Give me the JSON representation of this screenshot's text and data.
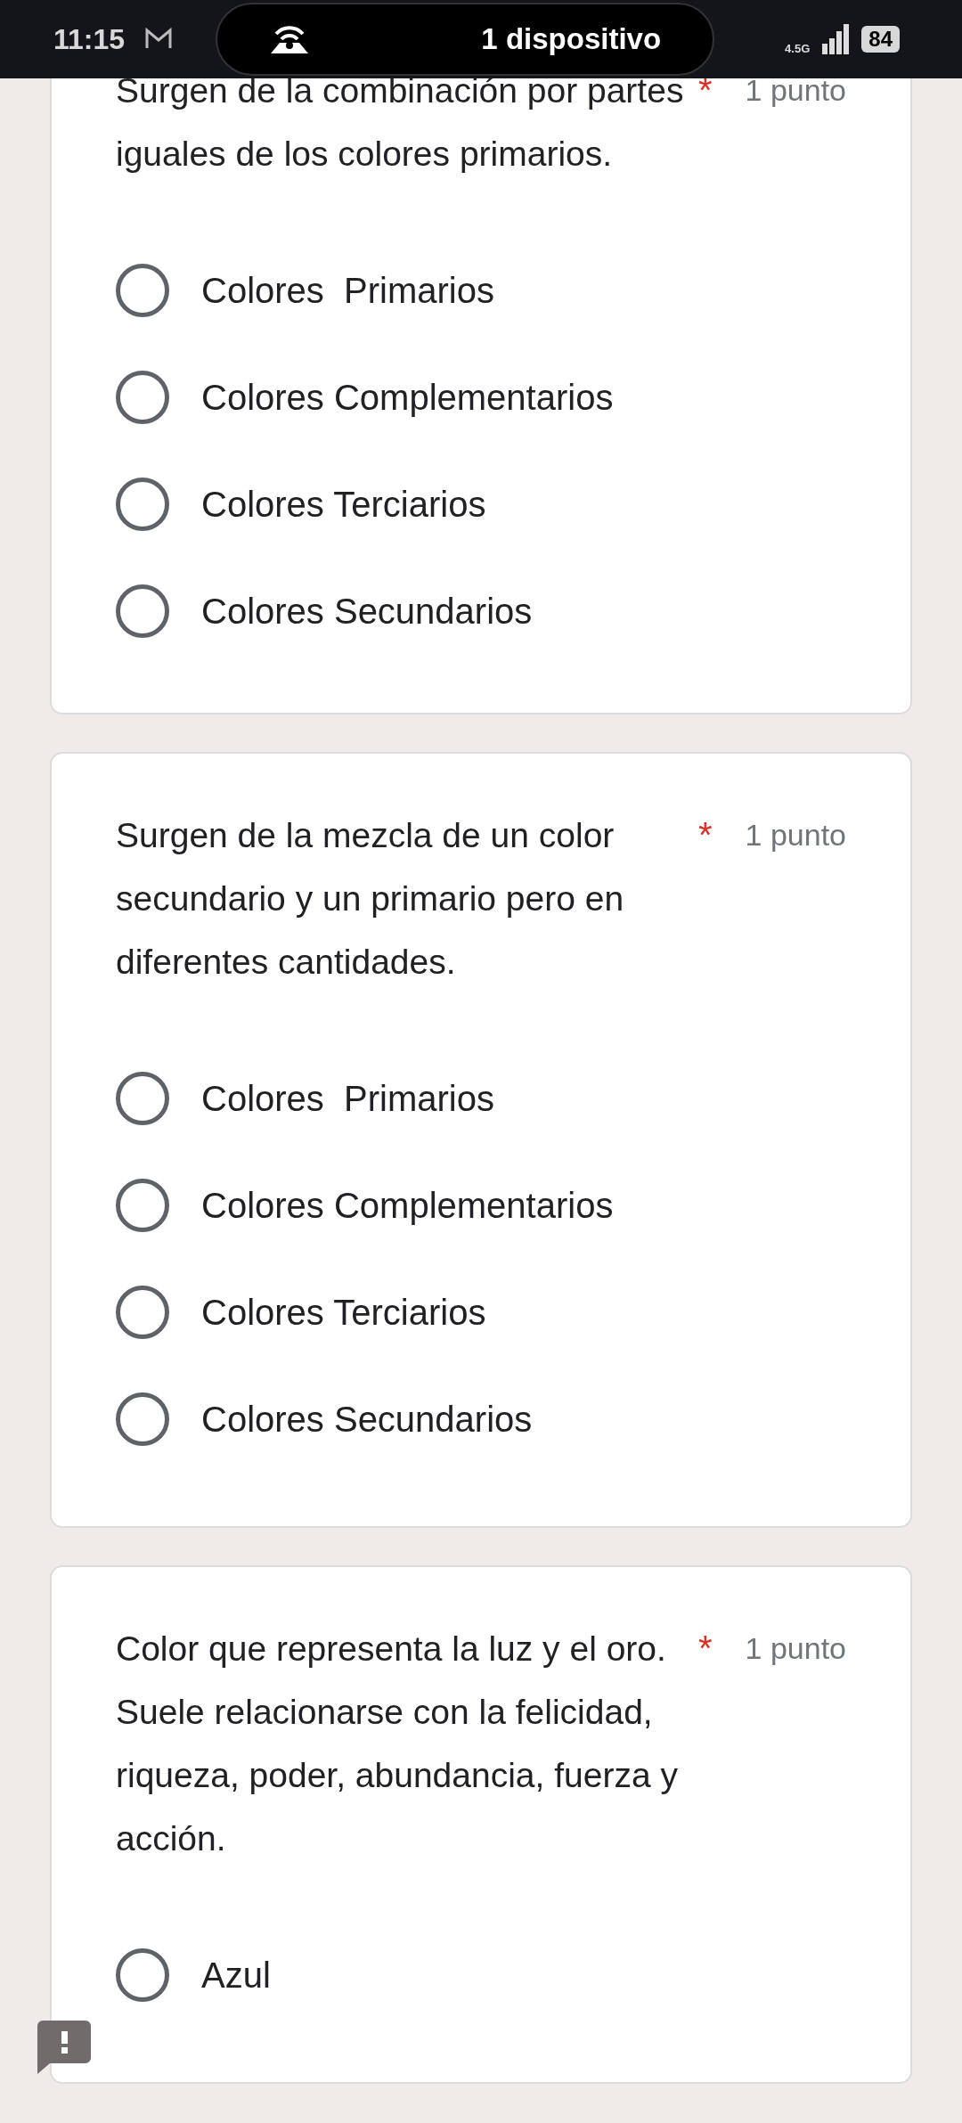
{
  "status_bar": {
    "time": "11:15",
    "hotspot_text": "1 dispositivo",
    "network": "4.5G",
    "battery": "84"
  },
  "questions": [
    {
      "text": "Surgen de la combinación por partes iguales de los colores primarios.",
      "required_mark": "*",
      "points": "1 punto",
      "options": [
        {
          "label": "Colores  Primarios",
          "selected": false
        },
        {
          "label": "Colores Complementarios",
          "selected": false
        },
        {
          "label": "Colores Terciarios",
          "selected": false
        },
        {
          "label": "Colores Secundarios",
          "selected": false
        }
      ]
    },
    {
      "text": "Surgen de la mezcla de un color secundario y un primario pero en diferentes cantidades.",
      "required_mark": "*",
      "points": "1 punto",
      "options": [
        {
          "label": "Colores  Primarios",
          "selected": false
        },
        {
          "label": "Colores Complementarios",
          "selected": false
        },
        {
          "label": "Colores Terciarios",
          "selected": false
        },
        {
          "label": "Colores Secundarios",
          "selected": false
        }
      ]
    },
    {
      "text": "Color que representa la luz y el oro. Suele relacionarse con la felicidad, riqueza, poder, abundancia, fuerza y acción.",
      "required_mark": "*",
      "points": "1 punto",
      "options": [
        {
          "label": "Azul",
          "selected": false
        }
      ]
    }
  ]
}
